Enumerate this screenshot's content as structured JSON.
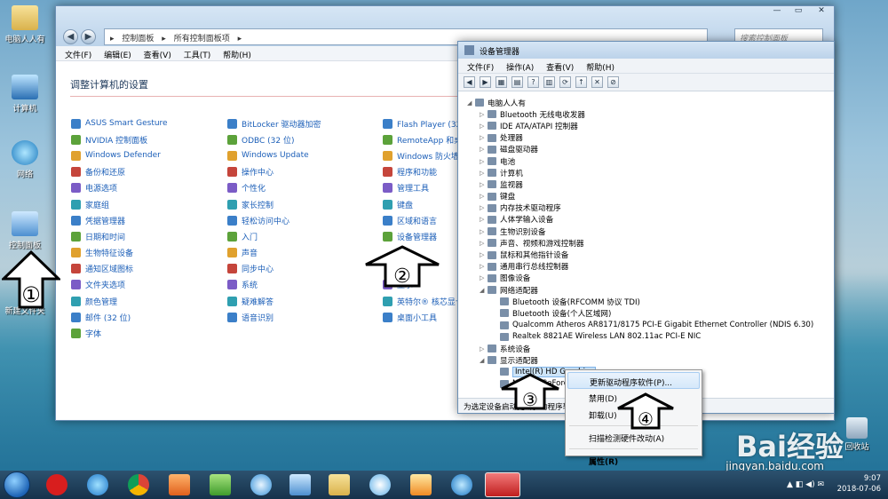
{
  "desktop": {
    "icons": [
      {
        "label": "电脑人人有"
      },
      {
        "label": "计算机"
      },
      {
        "label": "网络"
      },
      {
        "label": "控制面板"
      },
      {
        "label": "新建文件夹"
      }
    ],
    "recycle_bin": "回收站"
  },
  "control_panel": {
    "breadcrumb": [
      "控制面板",
      "所有控制面板项"
    ],
    "search_placeholder": "搜索控制面板",
    "menu": [
      "文件(F)",
      "编辑(E)",
      "查看(V)",
      "工具(T)",
      "帮助(H)"
    ],
    "heading": "调整计算机的设置",
    "col1": [
      "ASUS Smart Gesture",
      "NVIDIA 控制面板",
      "Windows Defender",
      "备份和还原",
      "电源选项",
      "家庭组",
      "凭据管理器",
      "日期和时间",
      "生物特征设备",
      "通知区域图标",
      "文件夹选项",
      "颜色管理",
      "邮件 (32 位)",
      "字体"
    ],
    "col2": [
      "BitLocker 驱动器加密",
      "ODBC (32 位)",
      "Windows Update",
      "操作中心",
      "个性化",
      "家长控制",
      "轻松访问中心",
      "入门",
      "声音",
      "同步中心",
      "系统",
      "疑难解答",
      "语音识别"
    ],
    "col3": [
      "Flash Player (32 位)",
      "RemoteApp 和桌面连接",
      "Windows 防火墙",
      "程序和功能",
      "管理工具",
      "键盘",
      "区域和语言",
      "设备管理器",
      "",
      "",
      "显示",
      "英特尔® 核芯显卡",
      "桌面小工具"
    ],
    "col3_partial": [
      "Flash Player (32 位",
      "RemoteApp 和桌",
      "Windows 防火墙",
      "程序和功能",
      "管理工具",
      "键盘",
      "区域和语言",
      "设备管理器",
      "",
      "",
      "显示",
      "英特尔® 核芯显卡",
      "桌面小工具"
    ]
  },
  "device_manager": {
    "title": "设备管理器",
    "menu": [
      "文件(F)",
      "操作(A)",
      "查看(V)",
      "帮助(H)"
    ],
    "root": "电脑人人有",
    "nodes": [
      {
        "text": "Bluetooth 无线电收发器",
        "level": 1,
        "toggle": "▷"
      },
      {
        "text": "IDE ATA/ATAPI 控制器",
        "level": 1,
        "toggle": "▷"
      },
      {
        "text": "处理器",
        "level": 1,
        "toggle": "▷"
      },
      {
        "text": "磁盘驱动器",
        "level": 1,
        "toggle": "▷"
      },
      {
        "text": "电池",
        "level": 1,
        "toggle": "▷"
      },
      {
        "text": "计算机",
        "level": 1,
        "toggle": "▷"
      },
      {
        "text": "监视器",
        "level": 1,
        "toggle": "▷"
      },
      {
        "text": "键盘",
        "level": 1,
        "toggle": "▷"
      },
      {
        "text": "内存技术驱动程序",
        "level": 1,
        "toggle": "▷"
      },
      {
        "text": "人体学输入设备",
        "level": 1,
        "toggle": "▷"
      },
      {
        "text": "生物识别设备",
        "level": 1,
        "toggle": "▷"
      },
      {
        "text": "声音、视频和游戏控制器",
        "level": 1,
        "toggle": "▷"
      },
      {
        "text": "鼠标和其他指针设备",
        "level": 1,
        "toggle": "▷"
      },
      {
        "text": "通用串行总线控制器",
        "level": 1,
        "toggle": "▷"
      },
      {
        "text": "图像设备",
        "level": 1,
        "toggle": "▷"
      },
      {
        "text": "网络适配器",
        "level": 1,
        "toggle": "◢"
      },
      {
        "text": "Bluetooth 设备(RFCOMM 协议 TDI)",
        "level": 2,
        "toggle": ""
      },
      {
        "text": "Bluetooth 设备(个人区域网)",
        "level": 2,
        "toggle": ""
      },
      {
        "text": "Qualcomm Atheros AR8171/8175 PCI-E Gigabit Ethernet Controller (NDIS 6.30)",
        "level": 2,
        "toggle": ""
      },
      {
        "text": "Realtek 8821AE Wireless LAN 802.11ac PCI-E NIC",
        "level": 2,
        "toggle": ""
      },
      {
        "text": "系统设备",
        "level": 1,
        "toggle": "▷"
      },
      {
        "text": "显示适配器",
        "level": 1,
        "toggle": "◢"
      },
      {
        "text": "Intel(R) HD Graphics",
        "level": 2,
        "toggle": "",
        "selected": true
      },
      {
        "text": "NVIDIA GeForce",
        "level": 2,
        "toggle": ""
      }
    ],
    "status": "为选定设备启动更新驱动程序软件向导。"
  },
  "context_menu": {
    "items": [
      "更新驱动程序软件(P)...",
      "禁用(D)",
      "卸载(U)",
      "扫描检测硬件改动(A)",
      "属性(R)"
    ]
  },
  "annotations": [
    "①",
    "②",
    "③",
    "④"
  ],
  "watermark": {
    "brand": "Bai经验",
    "url": "jingyan.baidu.com"
  },
  "taskbar": {
    "time": "9:07",
    "date": "2018-07-06"
  }
}
